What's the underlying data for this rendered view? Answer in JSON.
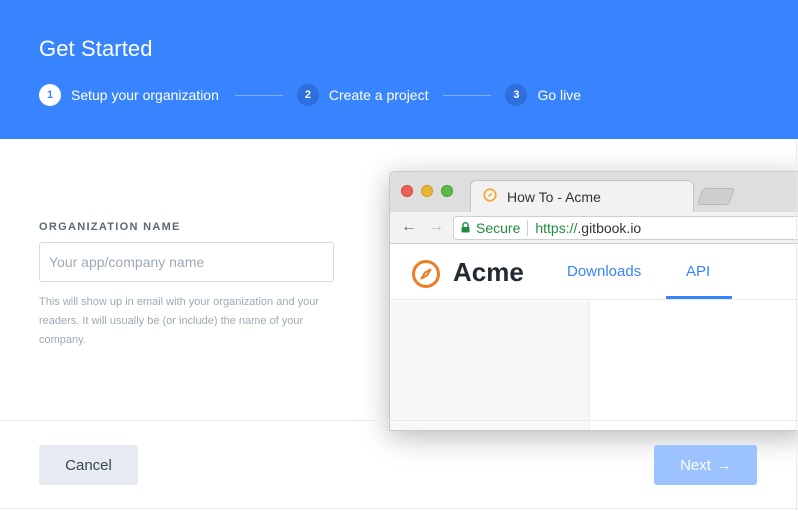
{
  "header": {
    "title": "Get Started",
    "steps": [
      {
        "number": "1",
        "label": "Setup your organization",
        "active": true
      },
      {
        "number": "2",
        "label": "Create a project",
        "active": false
      },
      {
        "number": "3",
        "label": "Go live",
        "active": false
      }
    ]
  },
  "form": {
    "label": "ORGANIZATION NAME",
    "value": "",
    "placeholder": "Your app/company name",
    "help": "This will show up in email with your organization and your readers. It will usually be (or include) the name of your company."
  },
  "preview": {
    "tab_title": "How To - Acme",
    "secure_label": "Secure",
    "url_scheme": "https://",
    "url_rest": ".gitbook.io",
    "site_name": "Acme",
    "nav_links": [
      "Downloads",
      "API"
    ],
    "active_link": "API"
  },
  "footer": {
    "cancel_label": "Cancel",
    "next_label": "Next",
    "next_icon": "→"
  },
  "colors": {
    "brand": "#3884ff",
    "logo": "#f5a623",
    "secure": "#1e8e3e"
  },
  "icons": {
    "secure": "lock-icon",
    "logo": "compass-icon",
    "back": "arrow-left-icon",
    "forward": "arrow-right-icon",
    "next": "arrow-right-icon"
  }
}
